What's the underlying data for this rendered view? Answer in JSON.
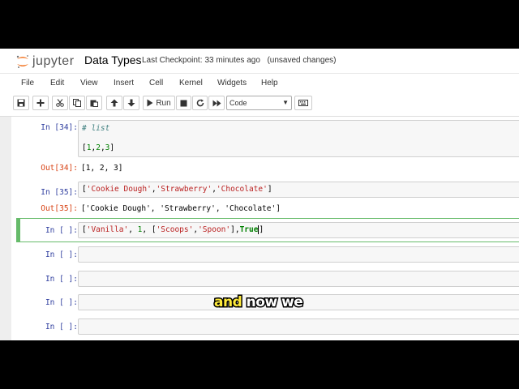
{
  "header": {
    "logo_text": "jupyter",
    "notebook_title": "Data Types",
    "checkpoint_label": "Last Checkpoint:",
    "checkpoint_time": "33 minutes ago",
    "unsaved": "(unsaved changes)"
  },
  "menu": [
    "File",
    "Edit",
    "View",
    "Insert",
    "Cell",
    "Kernel",
    "Widgets",
    "Help"
  ],
  "toolbar": {
    "icons": [
      "save-icon",
      "plus-icon",
      "cut-icon",
      "copy-icon",
      "paste-icon",
      "arrow-up-icon",
      "arrow-down-icon",
      "run-icon",
      "stop-icon",
      "restart-icon",
      "fast-forward-icon",
      "keyboard-icon"
    ],
    "run_label": "Run",
    "cell_type": "Code"
  },
  "cells": [
    {
      "in_prompt": "In [34]:",
      "code_line1": "# list",
      "code_line2_open": "[",
      "n1": "1",
      "n2": "2",
      "n3": "3",
      "code_line2_close": "]",
      "out_prompt": "Out[34]:",
      "output": "[1, 2, 3]"
    },
    {
      "in_prompt": "In [35]:",
      "s1": "'Cookie Dough'",
      "s2": "'Strawberry'",
      "s3": "'Chocolate'",
      "out_prompt": "Out[35]:",
      "output": "['Cookie Dough', 'Strawberry', 'Chocolate']"
    },
    {
      "in_prompt": "In [ ]:",
      "s1": "'Vanilla'",
      "n1": "1",
      "s2": "'Scoops'",
      "s3": "'Spoon'",
      "kw": "True"
    },
    {
      "in_prompt": "In [ ]:"
    },
    {
      "in_prompt": "In [ ]:"
    },
    {
      "in_prompt": "In [ ]:"
    },
    {
      "in_prompt": "In [ ]:"
    }
  ],
  "caption": {
    "highlight": "and",
    "rest": " now we"
  },
  "colors": {
    "selected_border": "#66bb6a",
    "in_prompt": "#303f9f",
    "out_prompt": "#d84315",
    "caption_highlight": "#ffeb3b"
  }
}
